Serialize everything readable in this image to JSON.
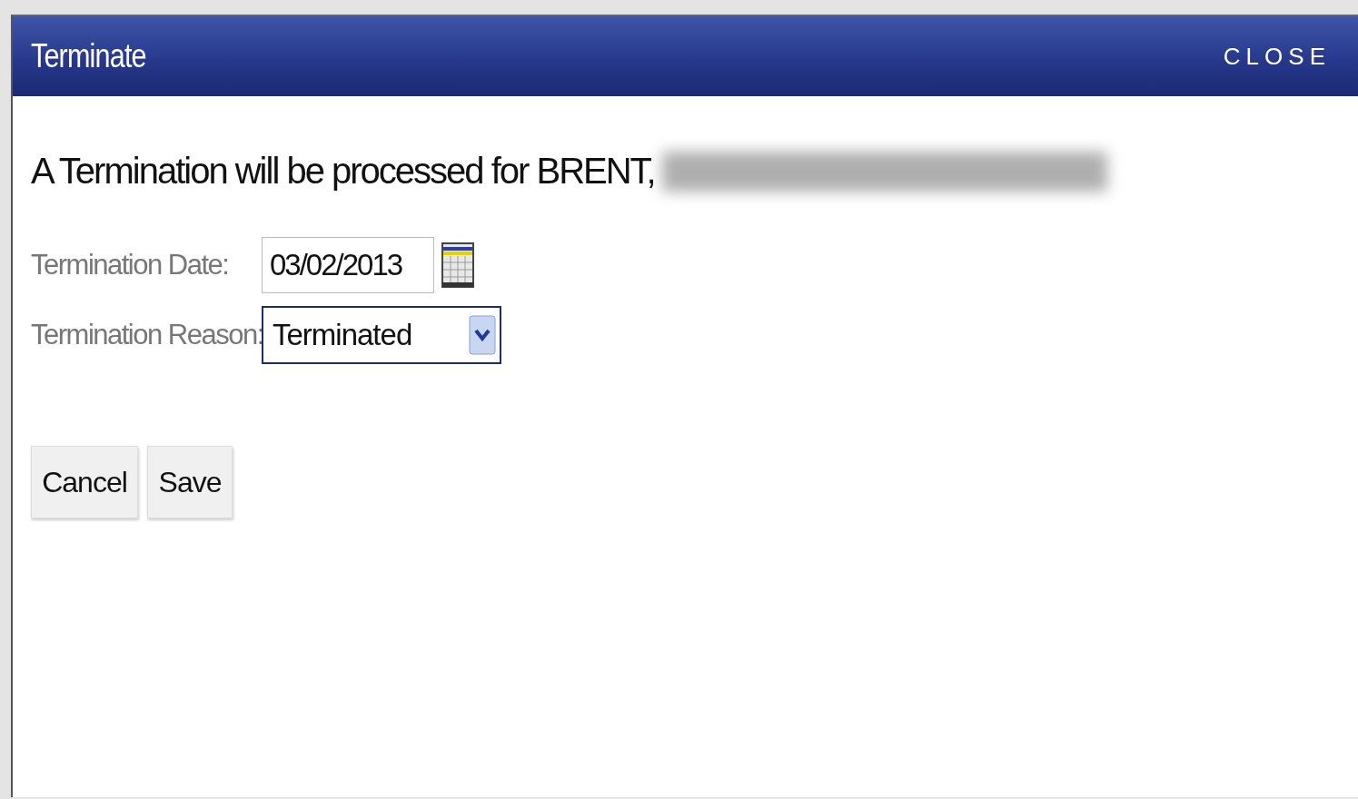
{
  "dialog": {
    "title": "Terminate",
    "close": "CLOSE"
  },
  "message": "A Termination will be processed for BRENT,",
  "fields": [
    {
      "label": "Termination Date:",
      "kind": "date",
      "value": "03/02/2013"
    },
    {
      "label": "Termination Reason:",
      "kind": "select",
      "value": "Terminated"
    }
  ],
  "buttons": [
    "Cancel",
    "Save"
  ]
}
